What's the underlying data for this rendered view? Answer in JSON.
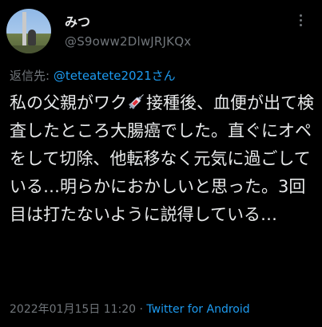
{
  "tweet": {
    "display_name": "みつ",
    "handle": "@S9oww2DlwJRJKQx",
    "reply_prefix": "返信先: ",
    "reply_to": "@teteatete2021さん",
    "text_part1": "私の父親がワク",
    "text_emoji_icon": "syringe-icon",
    "text_part2": "接種後、血便が出て検査したところ大腸癌でした。直ぐにオペをして切除、他転移なく元気に過ごしている…明らかにおかしいと思った。3回目は打たないように説得している…",
    "timestamp": "2022年01月15日 11:20",
    "separator": " · ",
    "client": "Twitter for Android"
  },
  "colors": {
    "background": "#000000",
    "text": "#e7e9ea",
    "muted": "#71767b",
    "link": "#1d9bf0"
  }
}
